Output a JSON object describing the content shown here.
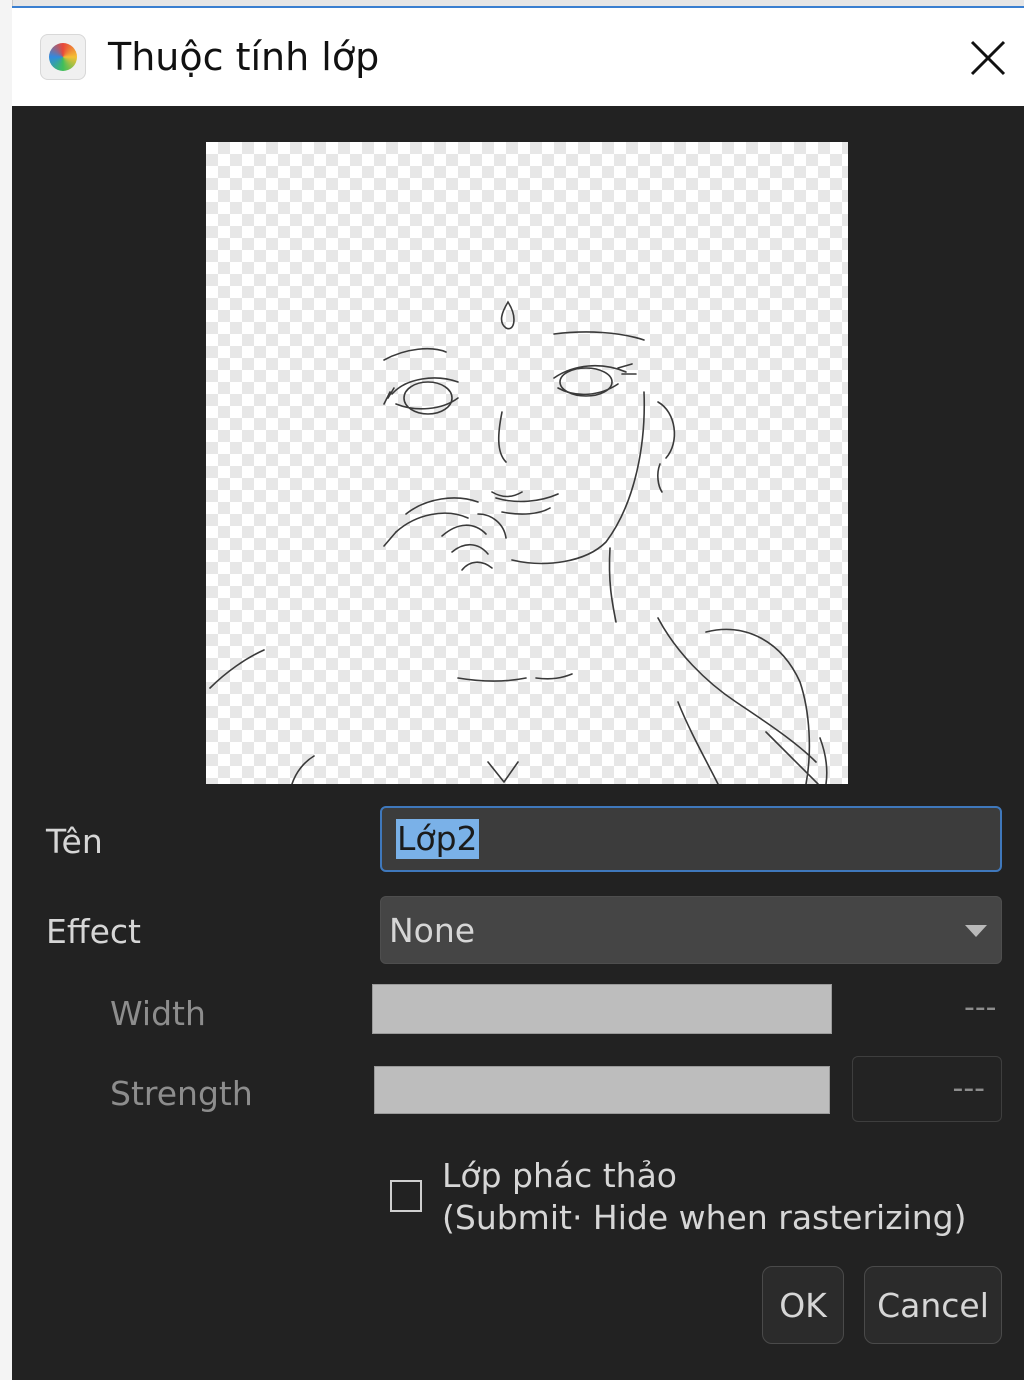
{
  "window": {
    "title": "Thuộc tính lớp",
    "app_icon": "app-palette-icon",
    "close_icon": "close-icon"
  },
  "preview": {
    "background": "checkerboard-transparency"
  },
  "form": {
    "name_label": "Tên",
    "name_value": "Lớp2",
    "effect_label": "Effect",
    "effect_value": "None",
    "width_label": "Width",
    "width_value": "---",
    "strength_label": "Strength",
    "strength_value": "---",
    "draft_line1": "Lớp phác thảo",
    "draft_line2": "(Submit· Hide when rasterizing)",
    "draft_checked": false
  },
  "buttons": {
    "ok": "OK",
    "cancel": "Cancel"
  },
  "colors": {
    "dialog_bg": "#222222",
    "accent": "#3f78bc",
    "selection": "#7ab1e8"
  }
}
